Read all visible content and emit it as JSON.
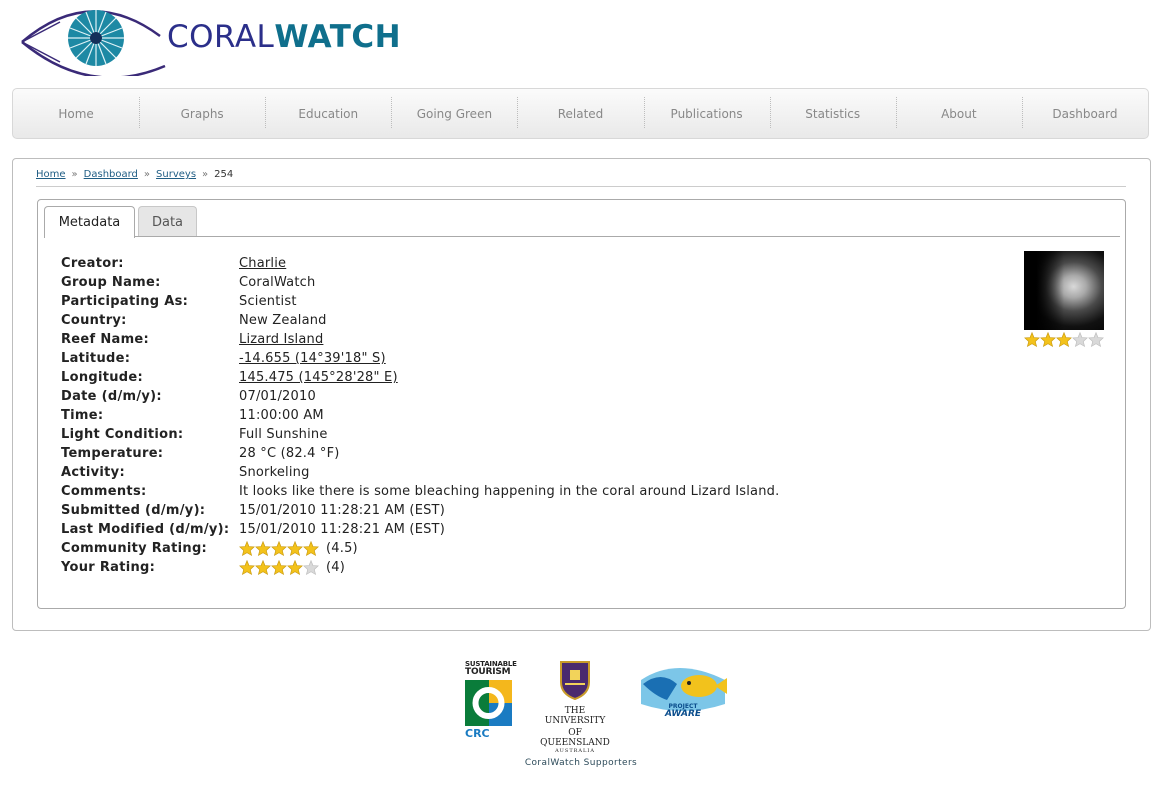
{
  "logo": {
    "text_coral": "CORAL",
    "text_watch": "WATCH",
    "icon": "eye-fish-logo-icon"
  },
  "nav": {
    "items": [
      "Home",
      "Graphs",
      "Education",
      "Going Green",
      "Related",
      "Publications",
      "Statistics",
      "About",
      "Dashboard"
    ]
  },
  "breadcrumb": {
    "items": [
      "Home",
      "Dashboard",
      "Surveys"
    ],
    "current": "254",
    "separator": "»"
  },
  "tabs": [
    {
      "label": "Metadata",
      "active": true
    },
    {
      "label": "Data",
      "active": false
    }
  ],
  "metadata": [
    {
      "label": "Creator:",
      "value": "Charlie",
      "link": true
    },
    {
      "label": "Group Name:",
      "value": "CoralWatch",
      "link": false
    },
    {
      "label": "Participating As:",
      "value": "Scientist",
      "link": false
    },
    {
      "label": "Country:",
      "value": "New Zealand",
      "link": false
    },
    {
      "label": "Reef Name:",
      "value": "Lizard Island",
      "link": true
    },
    {
      "label": "Latitude:",
      "value": "-14.655 (14°39'18\" S)",
      "link": true
    },
    {
      "label": "Longitude:",
      "value": "145.475 (145°28'28\" E)",
      "link": true
    },
    {
      "label": "Date (d/m/y):",
      "value": "07/01/2010",
      "link": false
    },
    {
      "label": "Time:",
      "value": "11:00:00 AM",
      "link": false
    },
    {
      "label": "Light Condition:",
      "value": "Full Sunshine",
      "link": false
    },
    {
      "label": "Temperature:",
      "value": "28 °C (82.4 °F)",
      "link": false
    },
    {
      "label": "Activity:",
      "value": "Snorkeling",
      "link": false
    },
    {
      "label": "Comments:",
      "value": "It looks like there is some bleaching happening in the coral around Lizard Island.",
      "link": false
    },
    {
      "label": "Submitted (d/m/y):",
      "value": "15/01/2010 11:28:21 AM (EST)",
      "link": false
    },
    {
      "label": "Last Modified (d/m/y):",
      "value": "15/01/2010 11:28:21 AM (EST)",
      "link": false
    }
  ],
  "community_rating": {
    "label": "Community Rating:",
    "value_text": "(4.5)",
    "stars_filled": 5,
    "stars_total": 5
  },
  "your_rating": {
    "label": "Your Rating:",
    "value_text": "(4)",
    "stars_filled": 4,
    "stars_total": 5
  },
  "creator_avatar": {
    "stars_filled": 3,
    "stars_total": 5
  },
  "footer": {
    "supporters_label": "CoralWatch Supporters",
    "sponsors": [
      {
        "name": "Sustainable Tourism CRC",
        "line1": "SUSTAINABLE",
        "line2": "TOURISM",
        "line3": "CRC"
      },
      {
        "name": "The University of Queensland",
        "line1": "THE UNIVERSITY",
        "line2": "OF QUEENSLAND",
        "line3": "AUSTRALIA"
      },
      {
        "name": "Project Aware",
        "line1": "PROJECT",
        "line2": "AWARE"
      }
    ]
  },
  "colors": {
    "star_filled": "#f3c21b",
    "star_empty": "#d9d9d9",
    "link": "#1f5d84",
    "brand_coral": "#2b2f8a",
    "brand_watch": "#0f6f8c"
  }
}
